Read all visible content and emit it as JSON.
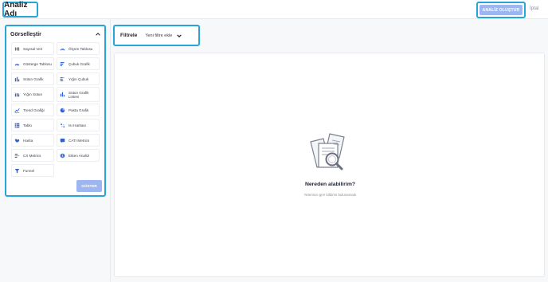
{
  "header": {
    "title": "Analiz Adı",
    "create_button": "ANALİZ OLUŞTUR",
    "cancel_link": "İptal"
  },
  "sidebar": {
    "title": "Görselleştir",
    "items": [
      {
        "label": "Sayısal Veri",
        "icon": "numeric-icon"
      },
      {
        "label": "Ölçüm Tablosu",
        "icon": "gauge-icon"
      },
      {
        "label": "Gösterge Tablosu",
        "icon": "dashboard-gauge-icon"
      },
      {
        "label": "Çubuk Grafik",
        "icon": "bar-chart-icon"
      },
      {
        "label": "Sütun Grafik",
        "icon": "column-chart-icon"
      },
      {
        "label": "Yığın Çubuk",
        "icon": "stacked-bar-icon"
      },
      {
        "label": "Yığın Sütun",
        "icon": "stacked-column-icon"
      },
      {
        "label": "Sütun Grafik Listesi",
        "icon": "column-list-icon"
      },
      {
        "label": "Trend Grafiği",
        "icon": "trend-chart-icon"
      },
      {
        "label": "Pasta Grafik",
        "icon": "pie-chart-icon"
      },
      {
        "label": "Tablo",
        "icon": "table-icon"
      },
      {
        "label": "Isı Haritası",
        "icon": "heatmap-icon"
      },
      {
        "label": "Harita",
        "icon": "map-icon"
      },
      {
        "label": "CATI Metrics",
        "icon": "cati-icon"
      },
      {
        "label": "CX Metrics",
        "icon": "cx-icon"
      },
      {
        "label": "Etken Analizi",
        "icon": "driver-analysis-icon"
      },
      {
        "label": "Funnel",
        "icon": "funnel-icon"
      }
    ],
    "show_button": "GÖSTER"
  },
  "filter": {
    "label": "Filtrele",
    "add_filter": "Yeni filtre ekle"
  },
  "empty_state": {
    "title": "Nereden alabilirim?",
    "subtitle": "Yeterince geri bildirim bulunamadı"
  },
  "colors": {
    "accent_outline": "#27a4d8",
    "primary_button": "#9bb6f0",
    "icon_blue": "#2f5fd6"
  }
}
